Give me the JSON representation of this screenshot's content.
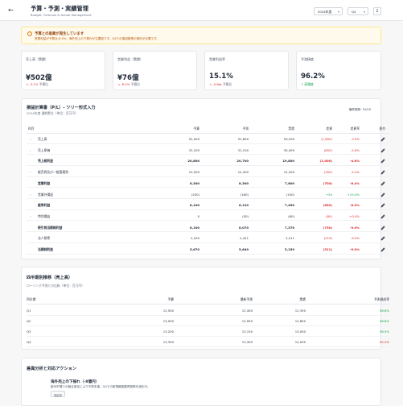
{
  "header": {
    "back_icon": "arrow-left-icon",
    "title": "予算・予測・実績管理",
    "subtitle": "Budget, Forecast & Actual Management",
    "fiscal_year": "2024年度",
    "quarter": "Q4",
    "download_icon": "download-icon"
  },
  "alert": {
    "title": "予算との差異が発生しています",
    "detail": "営業利益が予算比-8.4%。海外売上の下振れが主要因です。Q4での挽回施策の検討が必要です。"
  },
  "kpis": [
    {
      "label": "売上高（実績）",
      "value": "¥502億",
      "delta": "-3.2%",
      "delta_note": "予算比",
      "trend": "down"
    },
    {
      "label": "営業利益（実績）",
      "value": "¥76億",
      "delta": "-8.4%",
      "delta_note": "予算比",
      "trend": "down"
    },
    {
      "label": "営業利益率",
      "value": "15.1%",
      "delta": "-0.8pt",
      "delta_note": "予算比",
      "trend": "down"
    },
    {
      "label": "予測精度",
      "value": "96.2%",
      "delta": "高精度",
      "delta_note": "",
      "trend": "up"
    }
  ],
  "pl": {
    "title": "損益計算書（P/L）- ツリー形式入力",
    "subtitle": "2024年度 通期累計（単位：百万円）",
    "updated": "最終更新: 10/20",
    "columns": [
      "科目",
      "予算",
      "予測",
      "実績",
      "差異",
      "差異率",
      "操作"
    ],
    "rows": [
      {
        "name": "売上高",
        "expand": true,
        "bold": false,
        "budget": "52,000",
        "forecast": "51,800",
        "actual": "50,200",
        "variance": "(1,800)",
        "rate": "-3.5%",
        "sign": "neg"
      },
      {
        "name": "売上原価",
        "expand": true,
        "bold": false,
        "budget": "31,200",
        "forecast": "31,100",
        "actual": "30,400",
        "variance": "(800)",
        "rate": "-2.6%",
        "sign": "neg"
      },
      {
        "name": "売上総利益",
        "expand": false,
        "bold": true,
        "budget": "20,800",
        "forecast": "20,700",
        "actual": "19,800",
        "variance": "(1,000)",
        "rate": "-4.8%",
        "sign": "neg"
      },
      {
        "name": "販売費及び一般管理費",
        "expand": true,
        "bold": false,
        "budget": "12,500",
        "forecast": "12,400",
        "actual": "12,200",
        "variance": "(300)",
        "rate": "-2.4%",
        "sign": "neg"
      },
      {
        "name": "営業利益",
        "expand": false,
        "bold": true,
        "budget": "8,300",
        "forecast": "8,300",
        "actual": "7,600",
        "variance": "(700)",
        "rate": "-8.4%",
        "sign": "neg"
      },
      {
        "name": "営業外損益",
        "expand": true,
        "bold": false,
        "budget": "(200)",
        "forecast": "(180)",
        "actual": "(150)",
        "variance": "+50",
        "rate": "+25.0%",
        "sign": "pos"
      },
      {
        "name": "経常利益",
        "expand": false,
        "bold": true,
        "budget": "8,100",
        "forecast": "8,120",
        "actual": "7,450",
        "variance": "(650)",
        "rate": "-8.0%",
        "sign": "neg"
      },
      {
        "name": "特別損益",
        "expand": true,
        "bold": false,
        "budget": "0",
        "forecast": "(50)",
        "actual": "(80)",
        "variance": "(80)",
        "rate": "+0.0%",
        "sign": "neg"
      },
      {
        "name": "税引前当期純利益",
        "expand": false,
        "bold": true,
        "budget": "8,100",
        "forecast": "8,070",
        "actual": "7,370",
        "variance": "(730)",
        "rate": "-9.0%",
        "sign": "neg"
      },
      {
        "name": "法人税等",
        "expand": false,
        "bold": false,
        "budget": "2,430",
        "forecast": "2,421",
        "actual": "2,211",
        "variance": "(219)",
        "rate": "-9.0%",
        "sign": "neg"
      },
      {
        "name": "当期純利益",
        "expand": false,
        "bold": true,
        "budget": "5,670",
        "forecast": "5,649",
        "actual": "5,159",
        "variance": "(511)",
        "rate": "-9.0%",
        "sign": "neg"
      }
    ]
  },
  "quarterly": {
    "title": "四半期別推移（売上高）",
    "subtitle": "ローリング予測との比較（単位：百万円）",
    "columns": [
      "四半期",
      "予算",
      "最新予測",
      "実績",
      "予測達成率"
    ],
    "rows": [
      {
        "q": "Q1",
        "plan": "12,500",
        "forecast": "12,400",
        "actual": "12,350",
        "rate": "98.8%",
        "sign": "pos"
      },
      {
        "q": "Q2",
        "plan": "13,000",
        "forecast": "12,950",
        "actual": "12,850",
        "rate": "98.8%",
        "sign": "pos"
      },
      {
        "q": "Q3",
        "plan": "13,200",
        "forecast": "13,150",
        "actual": "13,000",
        "rate": "98.5%",
        "sign": "pos"
      },
      {
        "q": "Q4",
        "plan": "13,300",
        "forecast": "13,300",
        "actual": "12,000",
        "rate": "90.2%",
        "sign": "neg"
      }
    ]
  },
  "analysis": {
    "title": "差異分析と対応アクション",
    "item_title": "海外売上の下振れ（-8億円）",
    "item_desc": "欧州市場での競合激化により予算未達。Q4での新規顧客獲得施策を強化中。",
    "tag": "対応中"
  },
  "colors": {
    "accent_neg": "#dc2626",
    "accent_pos": "#16a34a",
    "alert_bg": "#fffaeb"
  }
}
